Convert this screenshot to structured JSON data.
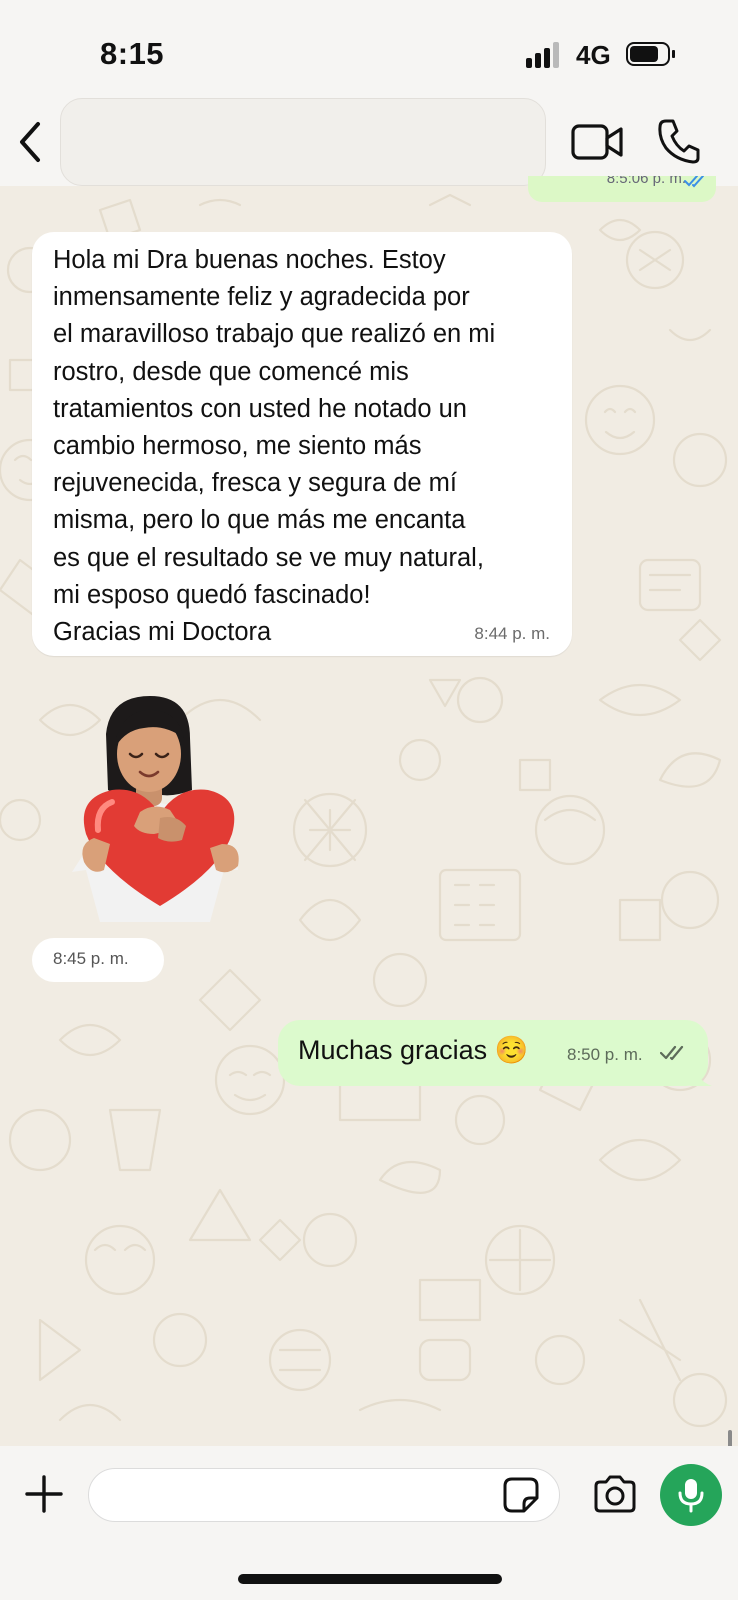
{
  "status_bar": {
    "time": "8:15",
    "network": "4G",
    "icons": [
      "signal-bars-icon",
      "battery-icon"
    ]
  },
  "header": {
    "contact_name": "",
    "icons": [
      "back-chevron-icon",
      "video-call-icon",
      "phone-call-icon"
    ]
  },
  "messages": [
    {
      "direction": "outgoing",
      "partial": true,
      "time": "8:5:06 p. m.",
      "status": "read",
      "tick_color": "#3b8fe6"
    },
    {
      "direction": "incoming",
      "text": "Hola mi Dra buenas noches. Estoy\ninmensamente feliz y agradecida por\nel maravilloso trabajo que realizó en mi\nrostro, desde que comencé mis\ntratamientos con usted he notado un\ncambio hermoso, me siento más\nrejuvenecida, fresca y segura de mí\nmisma, pero lo que más me encanta\nes que el resultado se ve muy natural,\nmi esposo quedó  fascinado!\nGracias mi Doctora",
      "time": "8:44 p. m."
    },
    {
      "direction": "incoming",
      "type": "sticker",
      "sticker": "avatar-hugging-heart-sticker",
      "time": "8:45 p. m."
    },
    {
      "direction": "outgoing",
      "text": "Muchas gracias ☺️",
      "time": "8:50 p. m.",
      "status": "delivered",
      "tick_color": "#5d6b5a"
    }
  ],
  "composer": {
    "placeholder": "",
    "icons": [
      "plus-icon",
      "sticker-icon",
      "camera-icon",
      "microphone-icon"
    ]
  },
  "colors": {
    "outgoing_bubble": "#dcfacd",
    "incoming_bubble": "#ffffff",
    "wallpaper": "#f1ece3",
    "mic_button": "#25a55a",
    "read_ticks": "#3b8fe6"
  }
}
